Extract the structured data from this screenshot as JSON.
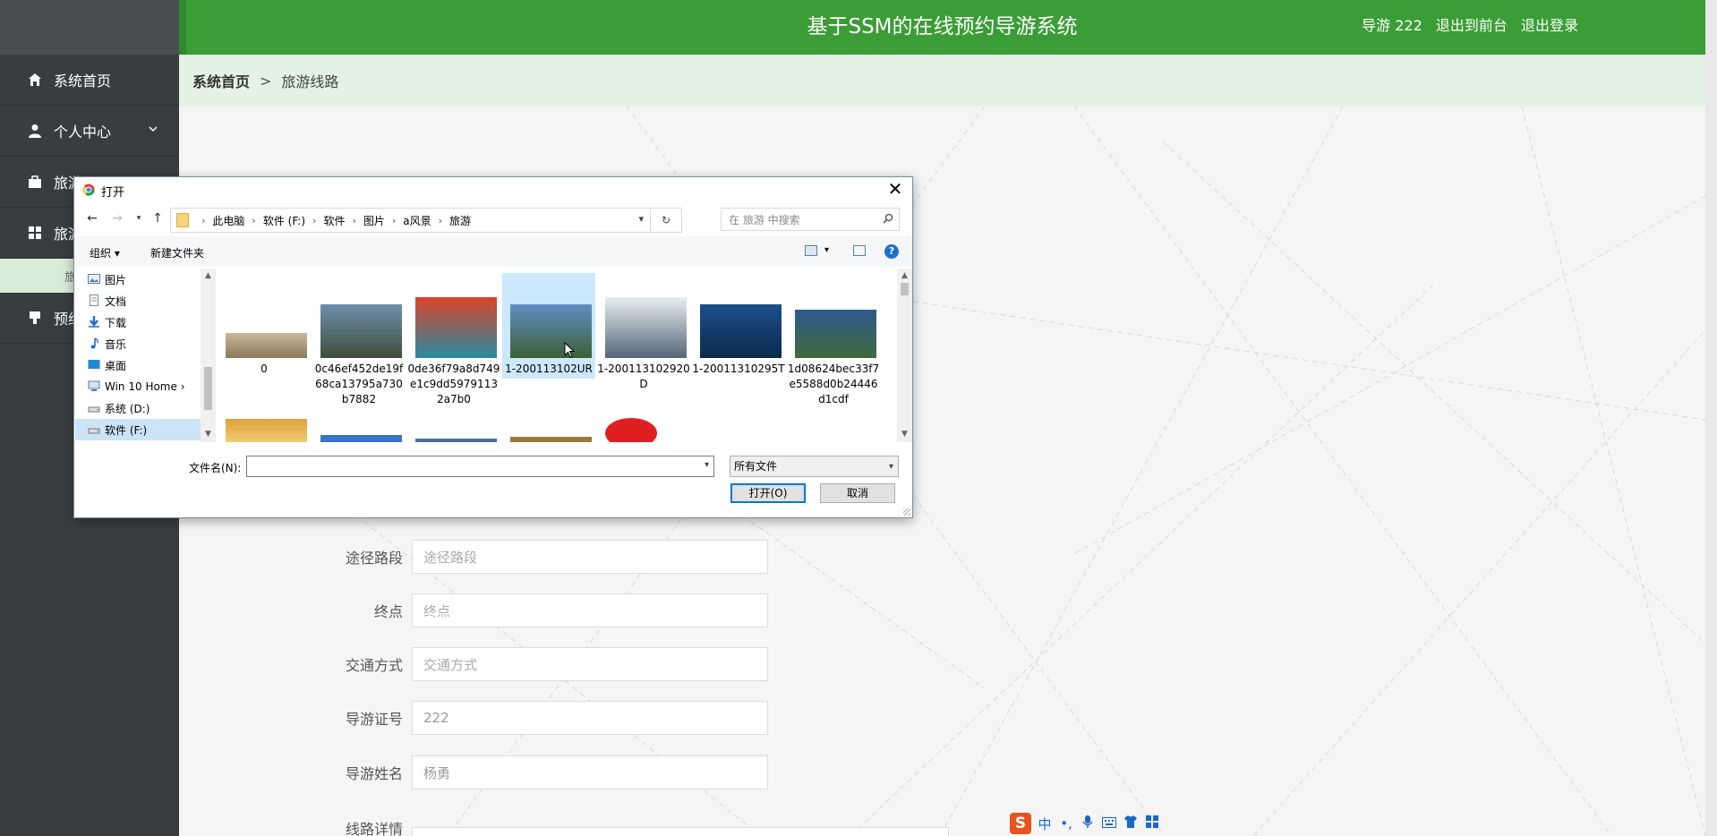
{
  "header": {
    "title": "基于SSM的在线预约导游系统",
    "user_label": "导游 222",
    "front_link": "退出到前台",
    "logout_link": "退出登录"
  },
  "sidebar": {
    "items": [
      {
        "label": "系统首页",
        "icon": "home-icon"
      },
      {
        "label": "个人中心",
        "icon": "user-icon"
      },
      {
        "label": "旅游",
        "icon": "briefcase-icon"
      },
      {
        "label": "旅游",
        "icon": "grid-icon"
      },
      {
        "label": "旅",
        "icon": ""
      },
      {
        "label": "预约",
        "icon": "bookmark-icon"
      }
    ]
  },
  "breadcrumb": {
    "home": "系统首页",
    "separator": ">",
    "current": "旅游线路"
  },
  "form": {
    "fields": [
      {
        "label": "途径路段",
        "placeholder": "途径路段"
      },
      {
        "label": "终点",
        "placeholder": "终点"
      },
      {
        "label": "交通方式",
        "placeholder": "交通方式"
      },
      {
        "label": "导游证号",
        "value": "222"
      },
      {
        "label": "导游姓名",
        "value": "杨勇"
      },
      {
        "label": "线路详情",
        "value": ""
      }
    ]
  },
  "dialog": {
    "title": "打开",
    "close": "✕",
    "path": [
      "此电脑",
      "软件 (F:)",
      "软件",
      "图片",
      "a风景",
      "旅游"
    ],
    "search_placeholder": "在 旅游 中搜索",
    "toolbar": {
      "organize": "组织 ▾",
      "new_folder": "新建文件夹",
      "help": "?"
    },
    "tree": [
      {
        "label": "图片"
      },
      {
        "label": "文档"
      },
      {
        "label": "下载"
      },
      {
        "label": "音乐"
      },
      {
        "label": "桌面"
      },
      {
        "label": "Win 10 Home ›"
      },
      {
        "label": "系统 (D:)"
      },
      {
        "label": "软件 (F:)"
      }
    ],
    "files": [
      {
        "name": "0",
        "colors": [
          "#c9b99a",
          "#8a7a5a"
        ]
      },
      {
        "name": "0c46ef452de19f68ca13795a730b7882",
        "colors": [
          "#6f8fae",
          "#3d4f3a"
        ]
      },
      {
        "name": "0de36f79a8d749e1c9dd59791132a7b0",
        "colors": [
          "#d8452a",
          "#2a8aa0"
        ]
      },
      {
        "name": "1-200113102UR",
        "colors": [
          "#5f8fc2",
          "#3d5f35"
        ]
      },
      {
        "name": "1-200113102920D",
        "colors": [
          "#e8eef4",
          "#556677"
        ]
      },
      {
        "name": "1-20011310295T",
        "colors": [
          "#1d4f8a",
          "#0b2a4f"
        ]
      },
      {
        "name": "1d08624bec33f7e5588d0b24446d1cdf",
        "colors": [
          "#2f5a8e",
          "#3e6a3a"
        ]
      }
    ],
    "filename_label": "文件名(N):",
    "filename_value": "",
    "filetype": "所有文件",
    "open_button": "打开(O)",
    "cancel_button": "取消"
  },
  "ime": {
    "logo": "S",
    "mode": "中"
  },
  "colors": {
    "header": "#3a9d35",
    "sidebar": "#393d3f",
    "breadcrumb": "#e3f2e3"
  }
}
